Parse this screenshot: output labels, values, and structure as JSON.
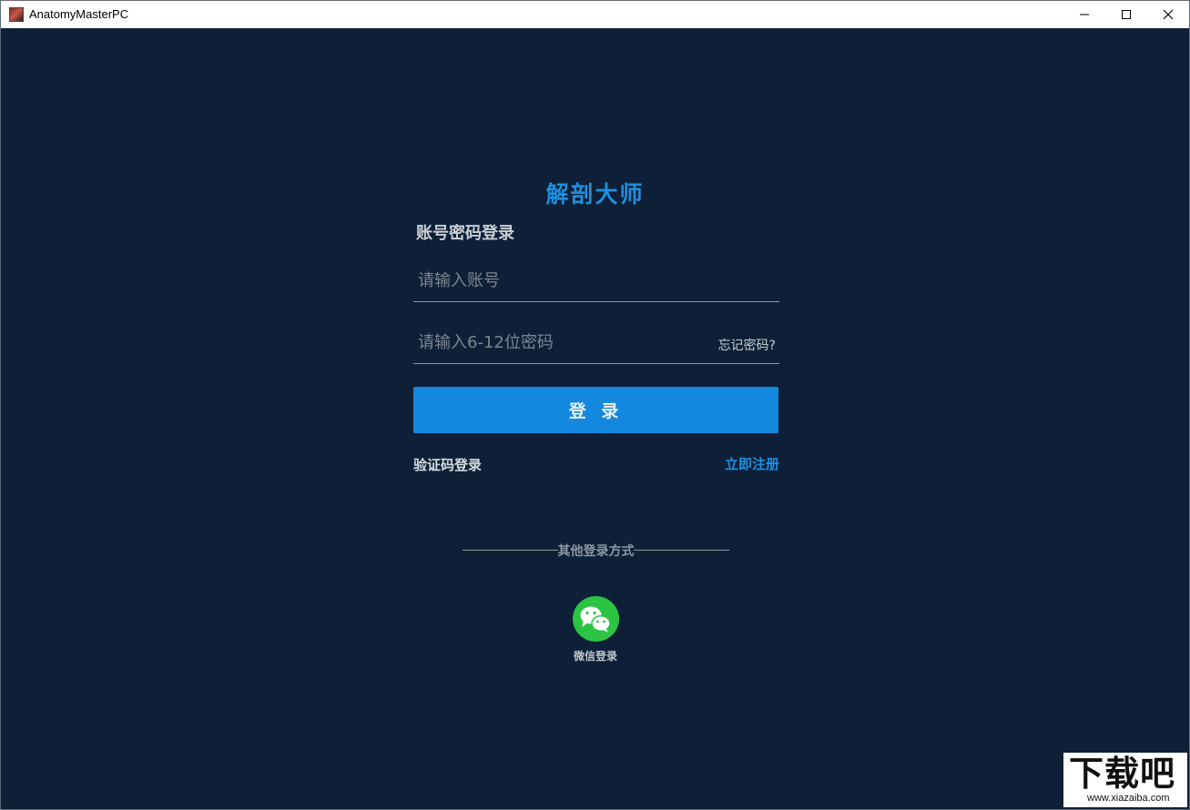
{
  "window": {
    "title": "AnatomyMasterPC",
    "controls": {
      "minimize": "minimize-icon",
      "maximize": "maximize-icon",
      "close": "close-icon"
    }
  },
  "brand": {
    "name": "解剖大师",
    "color": "#1e8fe0"
  },
  "login": {
    "heading": "账号密码登录",
    "account_placeholder": "请输入账号",
    "account_value": "",
    "password_placeholder": "请输入6-12位密码",
    "password_value": "",
    "forgot_label": "忘记密码?",
    "submit_label": "登 录",
    "sms_login_label": "验证码登录",
    "register_label": "立即注册"
  },
  "other_login": {
    "divider_label": "其他登录方式",
    "wechat_label": "微信登录",
    "wechat_icon": "wechat-icon",
    "wechat_color": "#2bc443"
  },
  "watermark": {
    "big": "下载吧",
    "small": "www.xiazaiba.com"
  },
  "colors": {
    "background": "#0d2037",
    "accent": "#1487df"
  }
}
